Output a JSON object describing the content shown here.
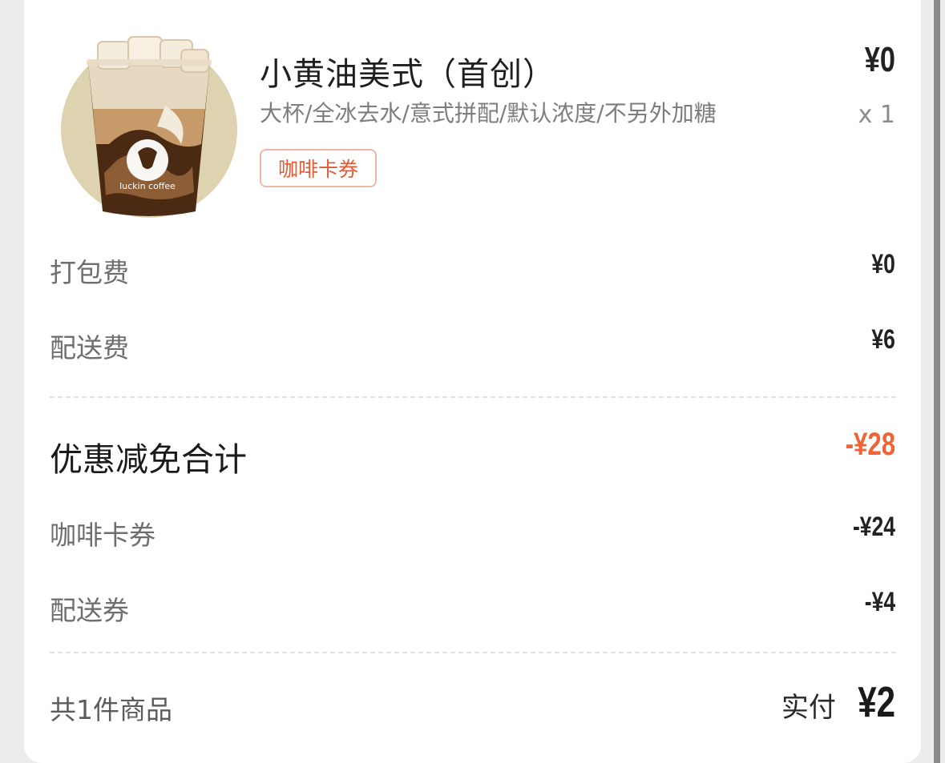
{
  "product": {
    "image_icon": "iced-coffee-cup-icon",
    "image_brand": "luckin coffee",
    "name": "小黄油美式（首创）",
    "specs": "大杯/全冰去水/意式拼配/默认浓度/不另外加糖",
    "coupon_tag": "咖啡卡券",
    "price": "¥0",
    "quantity": "x 1"
  },
  "fees": [
    {
      "label": "打包费",
      "value": "¥0"
    },
    {
      "label": "配送费",
      "value": "¥6"
    }
  ],
  "discount": {
    "title": "优惠减免合计",
    "total": "-¥28",
    "items": [
      {
        "label": "咖啡卡券",
        "value": "-¥24"
      },
      {
        "label": "配送券",
        "value": "-¥4"
      }
    ]
  },
  "footer": {
    "item_count": "共1件商品",
    "paid_label": "实付",
    "paid_amount": "¥2"
  },
  "colors": {
    "accent": "#ef6336",
    "coupon_border": "#f0b7a6",
    "text_primary": "#1f1f1f",
    "text_secondary": "#7d7d7d",
    "background": "#ececec",
    "card": "#ffffff"
  }
}
